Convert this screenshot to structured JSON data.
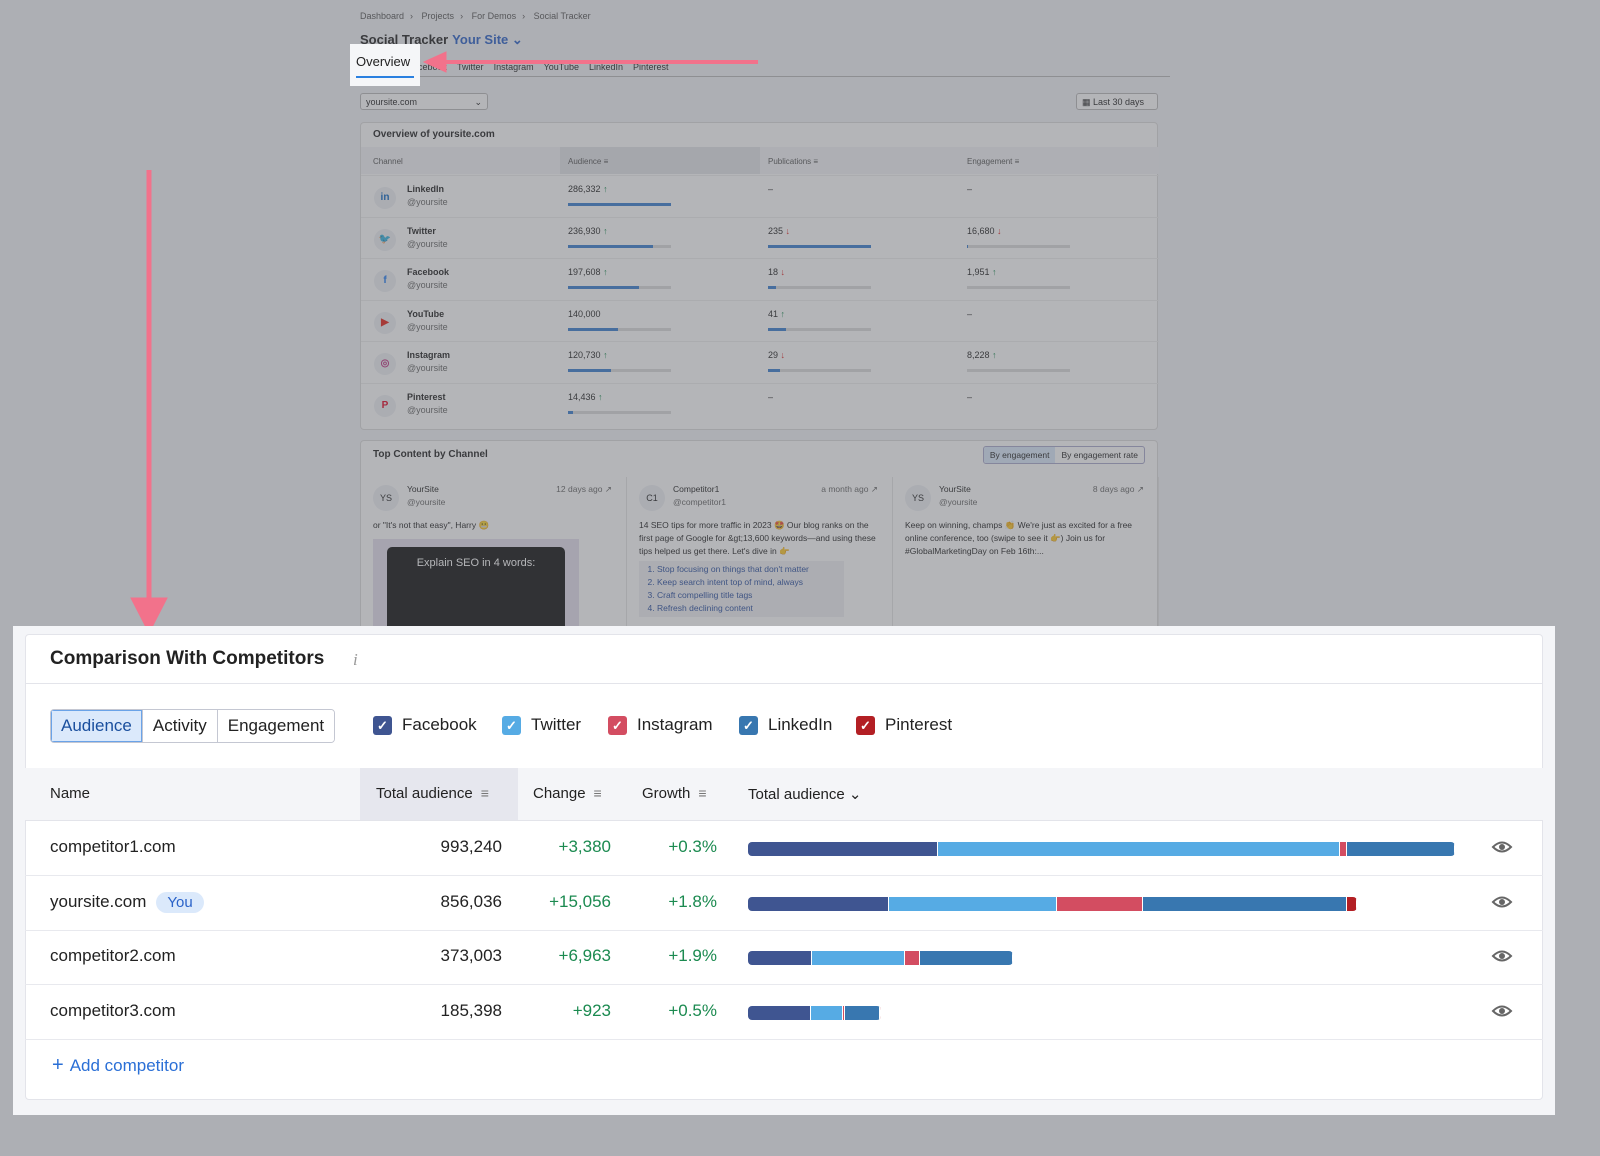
{
  "breadcrumb": [
    "Dashboard",
    "Projects",
    "For Demos",
    "Social Tracker"
  ],
  "header": {
    "title": "Social Tracker",
    "site": "Your Site"
  },
  "tabs": [
    "Overview",
    "Facebook",
    "Twitter",
    "Instagram",
    "YouTube",
    "LinkedIn",
    "Pinterest"
  ],
  "domain_select": "yoursite.com",
  "date_range": "Last 30 days",
  "overview": {
    "title": "Overview of yoursite.com",
    "columns": [
      "Channel",
      "Audience",
      "Publications",
      "Engagement"
    ],
    "rows": [
      {
        "name": "LinkedIn",
        "handle": "@yoursite",
        "icon": "in",
        "audience": "286,332",
        "aud_trend": "up",
        "aud_fill": 1.0,
        "pubs": "–",
        "pub_trend": "",
        "pub_fill": 0,
        "eng": "–",
        "eng_trend": "",
        "eng_fill": 0
      },
      {
        "name": "Twitter",
        "handle": "@yoursite",
        "icon": "tw",
        "audience": "236,930",
        "aud_trend": "up",
        "aud_fill": 0.83,
        "pubs": "235",
        "pub_trend": "down",
        "pub_fill": 1.0,
        "eng": "16,680",
        "eng_trend": "down",
        "eng_fill": 0.01
      },
      {
        "name": "Facebook",
        "handle": "@yoursite",
        "icon": "f",
        "audience": "197,608",
        "aud_trend": "up",
        "aud_fill": 0.69,
        "pubs": "18",
        "pub_trend": "down",
        "pub_fill": 0.08,
        "eng": "1,951",
        "eng_trend": "up",
        "eng_fill": 0.0
      },
      {
        "name": "YouTube",
        "handle": "@yoursite",
        "icon": "yt",
        "audience": "140,000",
        "aud_trend": "",
        "aud_fill": 0.49,
        "pubs": "41",
        "pub_trend": "up",
        "pub_fill": 0.17,
        "eng": "–",
        "eng_trend": "",
        "eng_fill": 0
      },
      {
        "name": "Instagram",
        "handle": "@yoursite",
        "icon": "ig",
        "audience": "120,730",
        "aud_trend": "up",
        "aud_fill": 0.42,
        "pubs": "29",
        "pub_trend": "down",
        "pub_fill": 0.12,
        "eng": "8,228",
        "eng_trend": "up",
        "eng_fill": 0.0
      },
      {
        "name": "Pinterest",
        "handle": "@yoursite",
        "icon": "p",
        "audience": "14,436",
        "aud_trend": "up",
        "aud_fill": 0.05,
        "pubs": "–",
        "pub_trend": "",
        "pub_fill": 0,
        "eng": "–",
        "eng_trend": "",
        "eng_fill": 0
      }
    ]
  },
  "top_content": {
    "title": "Top Content by Channel",
    "toggle": [
      "By engagement",
      "By engagement rate"
    ],
    "posts": [
      {
        "avatar": "YS",
        "name": "YourSite",
        "handle": "@yoursite",
        "time": "12 days ago",
        "text": "or \"It's not that easy\", Harry 😬",
        "image_text": "Explain SEO in 4 words:"
      },
      {
        "avatar": "C1",
        "name": "Competitor1",
        "handle": "@competitor1",
        "time": "a month ago",
        "text": "14 SEO tips for more traffic in 2023 🤩 Our blog ranks on the first page of Google for &gt;13,600 keywords—and using these tips helped us get there. Let's dive in 👉",
        "list": [
          "Stop focusing on things that don't matter",
          "Keep search intent top of mind, always",
          "Craft compelling title tags",
          "Refresh declining content"
        ]
      },
      {
        "avatar": "YS",
        "name": "YourSite",
        "handle": "@yoursite",
        "time": "8 days ago",
        "text": "Keep on winning, champs 👏 We're just as excited for a free online conference, too (swipe to see it 👉) Join us for #GlobalMarketingDay on Feb 16th:..."
      }
    ]
  },
  "comparison": {
    "title": "Comparison With Competitors",
    "metric_tabs": [
      "Audience",
      "Activity",
      "Engagement"
    ],
    "active_tab": "Audience",
    "channels": [
      {
        "label": "Facebook",
        "color": "#3f5591",
        "checked": true
      },
      {
        "label": "Twitter",
        "color": "#56abe4",
        "checked": true
      },
      {
        "label": "Instagram",
        "color": "#d34d61",
        "checked": true
      },
      {
        "label": "LinkedIn",
        "color": "#3877b0",
        "checked": true
      },
      {
        "label": "Pinterest",
        "color": "#b31f24",
        "checked": true
      }
    ],
    "columns": [
      "Name",
      "Total audience",
      "Change",
      "Growth",
      "Total audience"
    ],
    "you_badge": "You",
    "rows": [
      {
        "name": "competitor1.com",
        "you": false,
        "total": "993,240",
        "change": "+3,380",
        "growth": "+0.3%",
        "segments": [
          267000,
          565000,
          10000,
          151240,
          0
        ]
      },
      {
        "name": "yoursite.com",
        "you": true,
        "total": "856,036",
        "change": "+15,056",
        "growth": "+1.8%",
        "segments": [
          197608,
          236930,
          120730,
          286332,
          14436
        ]
      },
      {
        "name": "competitor2.com",
        "you": false,
        "total": "373,003",
        "change": "+6,963",
        "growth": "+1.9%",
        "segments": [
          90000,
          131000,
          21000,
          131003,
          0
        ]
      },
      {
        "name": "competitor3.com",
        "you": false,
        "total": "185,398",
        "change": "+923",
        "growth": "+0.5%",
        "segments": [
          88500,
          45000,
          2500,
          49000,
          398
        ]
      }
    ],
    "max_total": 993240,
    "add_label": "Add competitor"
  },
  "annotation_color": "#f2728b"
}
